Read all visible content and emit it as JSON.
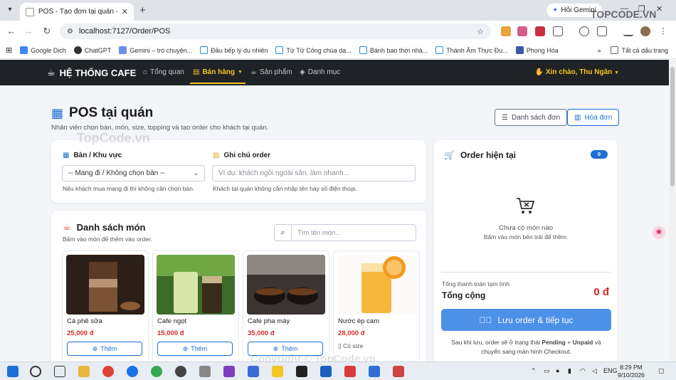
{
  "browser": {
    "tab_title": "POS - Tạo đơn tại quán - Cafe M",
    "gemini_label": "Hỏi Gemini",
    "url": "localhost:7127/Order/POS",
    "bookmarks": [
      "Google Dịch",
      "ChatGPT",
      "Gemini – trò chuyện...",
      "Đầu bếp lý du nhiên",
      "Tứ Tử Công chúa dạ...",
      "Bánh bao thời nhà...",
      "Thánh Ẩm Thực Đu...",
      "Phong Hóa"
    ],
    "bookmarks_more": "Tất cả dấu trang"
  },
  "nav": {
    "brand": "HỆ THỐNG CAFE",
    "items": [
      "Tổng quan",
      "Bán hàng",
      "Sản phẩm",
      "Danh mục"
    ],
    "greeting": "Xin chào, Thu Ngân"
  },
  "page": {
    "title": "POS tại quán",
    "subtitle": "Nhân viên chọn bàn, món, size, topping và tạo order cho khách tại quán.",
    "btn_orders": "Danh sách đơn",
    "btn_invoice": "Hóa đơn"
  },
  "table_section": {
    "label": "Bàn / Khu vực",
    "select_value": "-- Mang đi / Không chọn bàn --",
    "hint": "Nếu khách mua mang đi thì không cần chọn bàn."
  },
  "note_section": {
    "label": "Ghi chú order",
    "placeholder": "Ví dụ: khách ngồi ngoài sân, làm nhanh...",
    "hint": "Khách tại quán không cần nhập tên hay số điện thoại."
  },
  "menu": {
    "title": "Danh sách món",
    "subtitle": "Bấm vào món để thêm vào order.",
    "search_placeholder": "Tìm tên món...",
    "products": [
      {
        "name": "Cà phê sữa",
        "price": "25,000 đ",
        "action": "Thêm"
      },
      {
        "name": "Cafe ngọt",
        "price": "15,000 đ",
        "action": "Thêm"
      },
      {
        "name": "Cafe pha máy",
        "price": "35,000 đ",
        "action": "Thêm"
      },
      {
        "name": "Nước ép cam",
        "price": "28,000 đ",
        "size_note": "Có size"
      }
    ]
  },
  "order": {
    "title": "Order hiện tại",
    "count": "0",
    "empty_title": "Chưa có món nào",
    "empty_sub": "Bấm vào món bên trái để thêm.",
    "total_sub": "Tổng thanh toán tạm tính",
    "total_label": "Tổng cộng",
    "total_value": "0 đ",
    "save_button": "Lưu order & tiếp tục",
    "note_pre": "Sau khi lưu, order sẽ ở trạng thái ",
    "note_pending": "Pending",
    "note_plus": " + ",
    "note_unpaid": "Unpaid",
    "note_post": " và chuyển sang màn hình Checkout."
  },
  "watermark": {
    "brand": "TOPCODE.VN",
    "left": "TopCode.vn",
    "bottom": "Copyright © TopCode.vn"
  },
  "taskbar": {
    "lang": "ENG",
    "time": "8:29 PM",
    "date": "9/10/2026"
  },
  "colors": {
    "accent": "#1d6fd1",
    "navbar": "#1f2226",
    "highlight": "#f5c518",
    "price": "#d62b2b"
  }
}
